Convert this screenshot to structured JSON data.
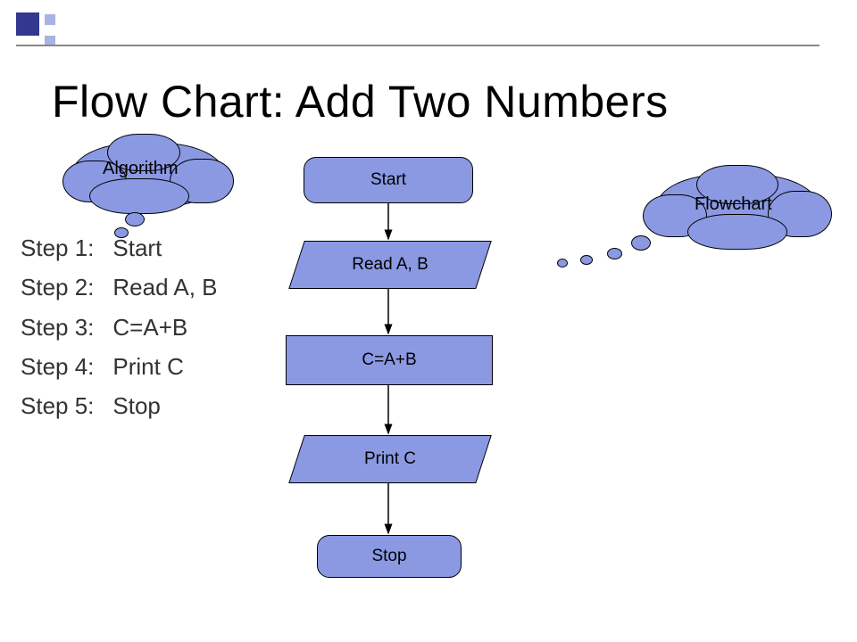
{
  "title": "Flow Chart: Add Two Numbers",
  "cloud_left": "Algorithm",
  "cloud_right": "Flowchart",
  "steps": [
    {
      "n": "Step 1:",
      "t": "Start"
    },
    {
      "n": "Step 2:",
      "t": "Read A, B"
    },
    {
      "n": "Step 3:",
      "t": "C=A+B"
    },
    {
      "n": "Step 4:",
      "t": "Print C"
    },
    {
      "n": "Step 5:",
      "t": "Stop"
    }
  ],
  "flow": {
    "start": "Start",
    "read": "Read A, B",
    "proc": "C=A+B",
    "print": "Print C",
    "stop": "Stop"
  },
  "chart_data": {
    "type": "flowchart",
    "nodes": [
      {
        "id": "start",
        "shape": "terminator",
        "label": "Start"
      },
      {
        "id": "read",
        "shape": "io",
        "label": "Read A, B"
      },
      {
        "id": "proc",
        "shape": "process",
        "label": "C=A+B"
      },
      {
        "id": "print",
        "shape": "io",
        "label": "Print C"
      },
      {
        "id": "stop",
        "shape": "terminator",
        "label": "Stop"
      }
    ],
    "edges": [
      {
        "from": "start",
        "to": "read"
      },
      {
        "from": "read",
        "to": "proc"
      },
      {
        "from": "proc",
        "to": "print"
      },
      {
        "from": "print",
        "to": "stop"
      }
    ]
  }
}
